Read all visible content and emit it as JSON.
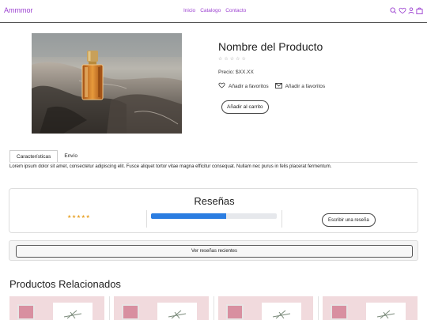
{
  "header": {
    "brand": "Ammmor",
    "nav": [
      "Inicio",
      "Catalogo",
      "Contacto"
    ],
    "icons": [
      "search-icon",
      "heart-icon",
      "user-icon",
      "bag-icon"
    ],
    "accent_color": "#9b3fd0"
  },
  "product": {
    "title": "Nombre del Producto",
    "rating_stars": "☆☆☆☆☆",
    "price": "Precio: $XX.XX",
    "favorite_label_1": "Añadir a favoritos",
    "favorite_label_2": "Añadir a favoritos",
    "add_to_cart": "Añadir al carrito"
  },
  "tabs": {
    "items": [
      "Características",
      "Envío"
    ],
    "active": "Características",
    "content": "Lorem ipsum dolor sit amet, consectetur adipiscing elit. Fusce aliquet tortor vitae magna efficitur consequat. Nullam nec purus in felis placerat fermentum."
  },
  "reviews": {
    "title": "Reseñas",
    "stars": "★★★★★",
    "progress": 0.6,
    "progress_color": "#2b7de1",
    "write_button": "Escribir una reseña",
    "recent_button": "Ver reseñas recientes"
  },
  "related": {
    "title": "Productos Relacionados",
    "card_count": 4
  }
}
